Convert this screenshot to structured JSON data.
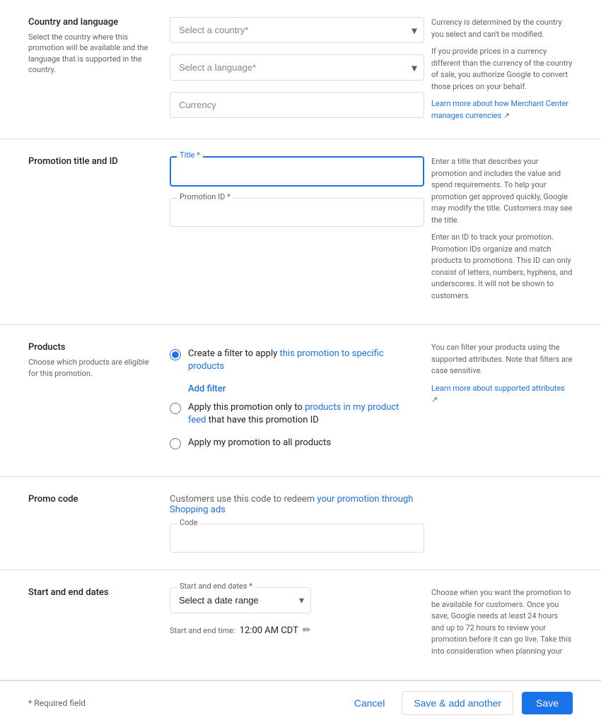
{
  "sections": {
    "country_language": {
      "title": "Country and language",
      "description": "Select the country where this promotion will be available and the language that is supported in the country.",
      "country_select_placeholder": "Select a country*",
      "language_select_placeholder": "Select a language*",
      "currency_placeholder": "Currency",
      "info_text_1": "Currency is determined by the country you select and can't be modified.",
      "info_text_2": "If you provide prices in a currency different than the currency of the country of sale, you authorize Google to convert those prices on your behalf.",
      "info_link": "Learn more about how Merchant Center manages currencies"
    },
    "promotion_title": {
      "title": "Promotion title and ID",
      "title_label": "Title *",
      "promotion_id_label": "Promotion ID *",
      "info_text_1": "Enter a title that describes your promotion and includes the value and spend requirements. To help your promotion get approved quickly, Google may modify the title. Customers may see the title.",
      "info_text_2": "Enter an ID to track your promotion. Promotion IDs organize and match products to promotions. This ID can only consist of letters, numbers, hyphens, and underscores. It will not be shown to customers."
    },
    "products": {
      "title": "Products",
      "description": "Choose which products are eligible for this promotion.",
      "radio_1_label": "Create a filter to apply this promotion to specific products",
      "radio_1_highlight": "this promotion to specific products",
      "add_filter_label": "Add filter",
      "radio_2_label": "Apply this promotion only to products in my product feed that have this promotion ID",
      "radio_2_highlight": "products in my product feed",
      "radio_3_label": "Apply my promotion to all products",
      "info_text_1": "You can filter your products using the supported attributes. Note that filters are case sensitive.",
      "info_link": "Learn more about supported attributes"
    },
    "promo_code": {
      "title": "Promo code",
      "description": "Customers use this code to redeem",
      "description_highlight": "your promotion through Shopping ads",
      "code_placeholder": "Code"
    },
    "dates": {
      "title": "Start and end dates",
      "date_range_label": "Start and end dates *",
      "date_range_placeholder": "Select a date range",
      "time_label": "Start and end time:",
      "time_value": "12:00 AM CDT",
      "info_text": "Choose when you want the promotion to be available for customers. Once you save, Google needs at least 24 hours and up to 72 hours to review your promotion before it can go live. Take this into consideration when planning your"
    }
  },
  "footer": {
    "required_note": "* Required field",
    "cancel_label": "Cancel",
    "save_add_label": "Save & add another",
    "save_label": "Save"
  }
}
